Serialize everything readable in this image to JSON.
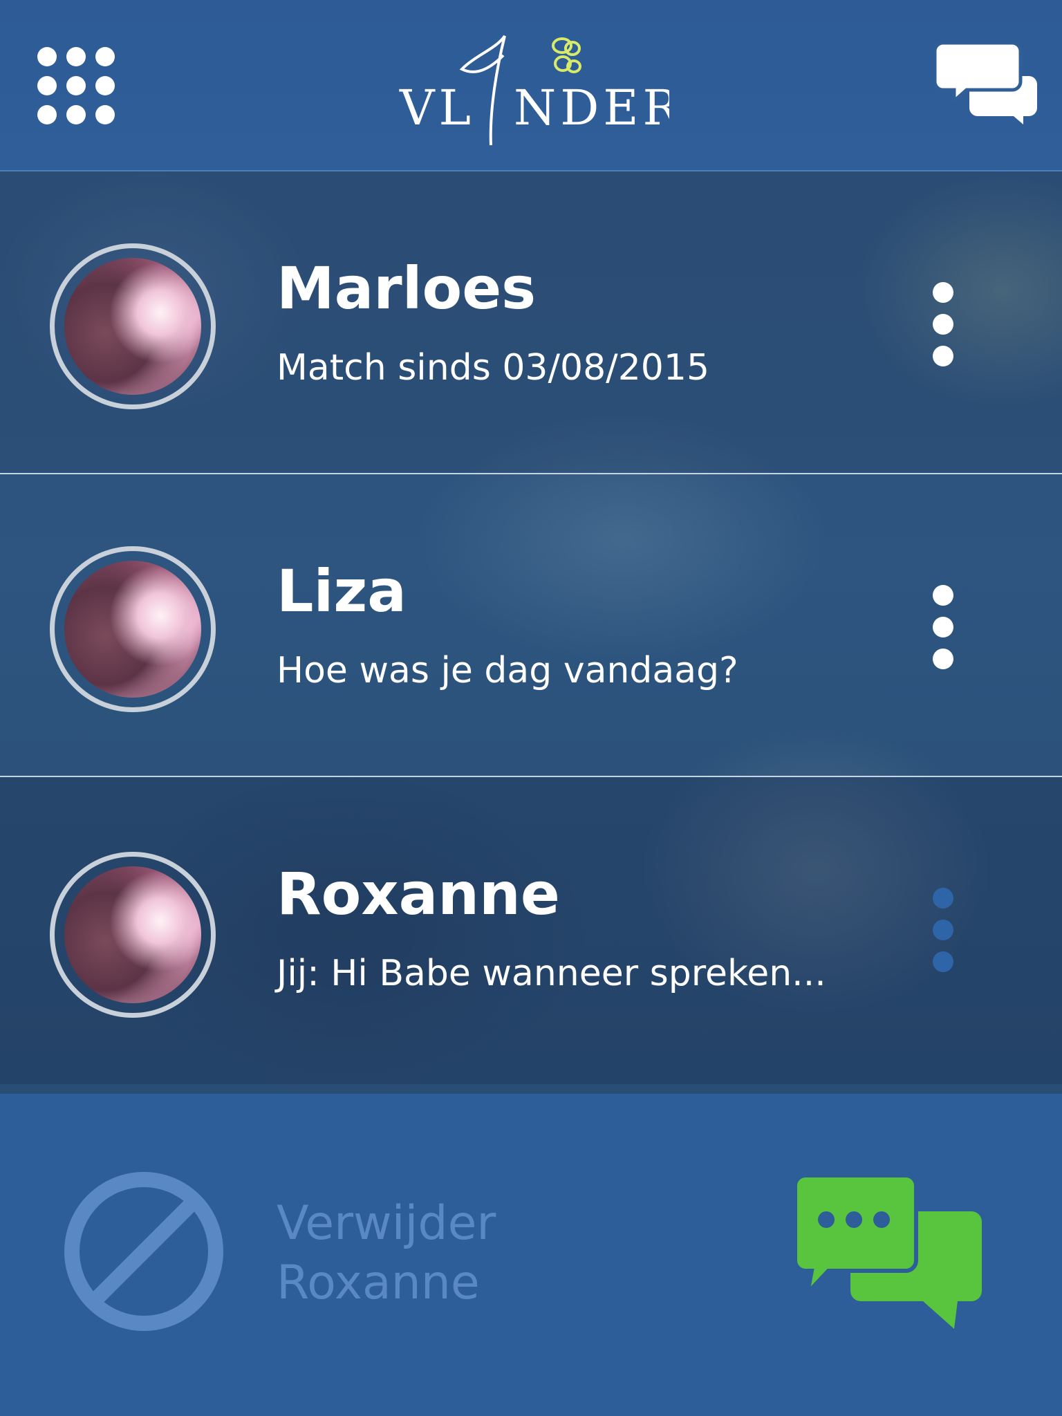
{
  "header": {
    "logo_text": "VLINDER",
    "menu_icon": "grid-menu-icon",
    "chat_icon": "chat-bubbles-icon"
  },
  "matches": [
    {
      "name": "Marloes",
      "subtitle": "Match sinds 03/08/2015"
    },
    {
      "name": "Liza",
      "subtitle": "Hoe was je dag vandaag?"
    },
    {
      "name": "Roxanne",
      "subtitle": "Jij: Hi Babe wanneer spreken..."
    }
  ],
  "action_bar": {
    "remove_line1": "Verwijder",
    "remove_line2": "Roxanne",
    "block_icon": "block-icon",
    "chat_icon": "chat-bubbles-icon"
  },
  "colors": {
    "header": "#2f5e99",
    "action_bar": "#2e5e9a",
    "chat_green": "#59c43e",
    "logo_butterfly": "#d7ea6a",
    "muted_blue": "#5a88c4"
  }
}
